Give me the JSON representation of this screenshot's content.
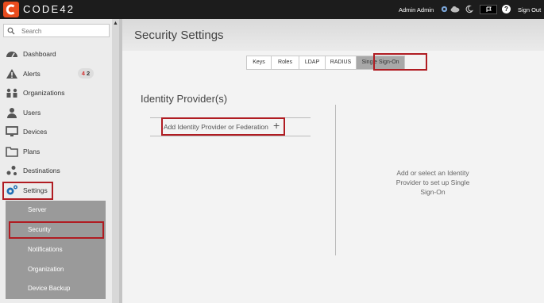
{
  "app": {
    "brand": "CODE42",
    "accent": "#e84c1e",
    "highlight": "#b01c22"
  },
  "topbar": {
    "user": "Admin Admin",
    "icons": [
      "gear-icon",
      "cloud-icon",
      "moon-icon",
      "flag-icon",
      "help-icon"
    ],
    "help_glyph": "?",
    "sign_out": "Sign Out"
  },
  "sidebar": {
    "search_placeholder": "Search",
    "items": [
      {
        "label": "Dashboard",
        "icon": "dashboard-icon"
      },
      {
        "label": "Alerts",
        "icon": "alert-icon",
        "badge": [
          "4",
          "2"
        ]
      },
      {
        "label": "Organizations",
        "icon": "organizations-icon"
      },
      {
        "label": "Users",
        "icon": "user-icon"
      },
      {
        "label": "Devices",
        "icon": "monitor-icon"
      },
      {
        "label": "Plans",
        "icon": "folder-icon"
      },
      {
        "label": "Destinations",
        "icon": "destinations-icon"
      },
      {
        "label": "Settings",
        "icon": "settings-icon"
      }
    ],
    "settings_sub": [
      "Server",
      "Security",
      "Notifications",
      "Organization",
      "Device Backup"
    ]
  },
  "main": {
    "title": "Security Settings",
    "tabs": [
      "Keys",
      "Roles",
      "LDAP",
      "RADIUS",
      "Single Sign-On"
    ],
    "active_tab": "Single Sign-On",
    "identity": {
      "heading": "Identity Provider(s)",
      "add_label": "Add Identity Provider or Federation",
      "add_glyph": "+"
    },
    "help_text": "Add or select an Identity Provider to set up Single Sign-On"
  }
}
